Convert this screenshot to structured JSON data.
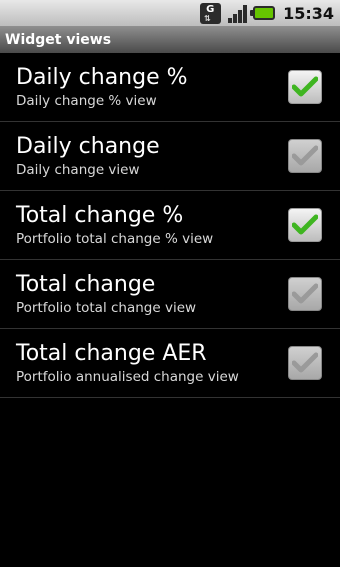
{
  "status_bar": {
    "data_icon_letter": "G",
    "time": "15:34",
    "battery_color": "#66c400",
    "icons": [
      "gprs-data-icon",
      "signal-strength-icon",
      "battery-icon"
    ]
  },
  "header": {
    "title": "Widget views"
  },
  "items": [
    {
      "title": "Daily change %",
      "subtitle": "Daily change % view",
      "checked": true
    },
    {
      "title": "Daily change",
      "subtitle": "Daily change view",
      "checked": false
    },
    {
      "title": "Total change %",
      "subtitle": "Portfolio total change % view",
      "checked": true
    },
    {
      "title": "Total change",
      "subtitle": "Portfolio total change view",
      "checked": false
    },
    {
      "title": "Total change AER",
      "subtitle": "Portfolio annualised change view",
      "checked": false
    }
  ],
  "colors": {
    "check_active": "#3fb521",
    "check_inactive": "#9a9a9a",
    "background": "#000000"
  }
}
